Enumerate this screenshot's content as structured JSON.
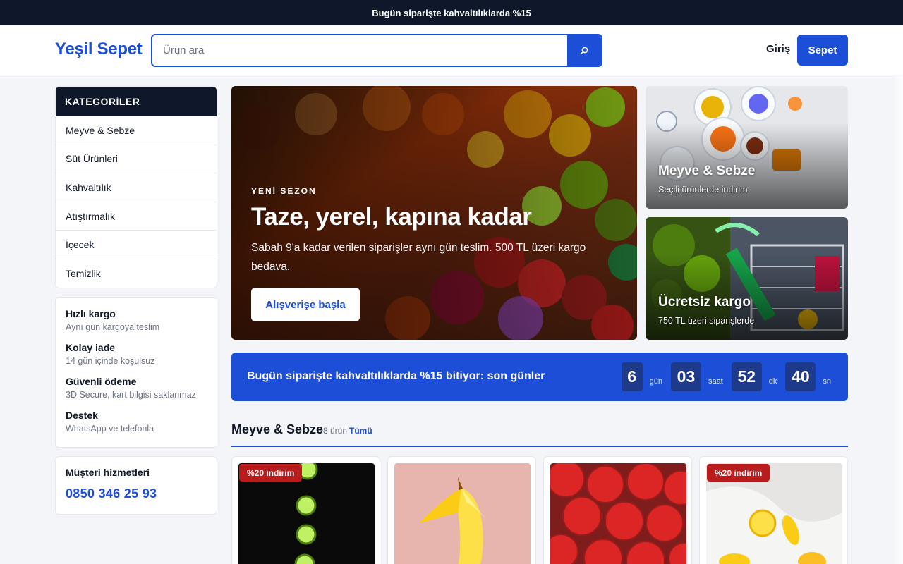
{
  "announcement": "Bugün siparişte kahvaltılıklarda %15",
  "header": {
    "logo": "Yeşil Sepet",
    "search_placeholder": "Ürün ara",
    "search_icon": "search-icon",
    "login_label": "Giriş",
    "cart_label": "Sepet"
  },
  "sidebar": {
    "categories_title": "KATEGORİLER",
    "categories": [
      {
        "label": "Meyve & Sebze"
      },
      {
        "label": "Süt Ürünleri"
      },
      {
        "label": "Kahvaltılık"
      },
      {
        "label": "Atıştırmalık"
      },
      {
        "label": "İçecek"
      },
      {
        "label": "Temizlik"
      }
    ],
    "features": [
      {
        "title": "Hızlı kargo",
        "desc": "Aynı gün kargoya teslim"
      },
      {
        "title": "Kolay iade",
        "desc": "14 gün içinde koşulsuz"
      },
      {
        "title": "Güvenli ödeme",
        "desc": "3D Secure, kart bilgisi saklanmaz"
      },
      {
        "title": "Destek",
        "desc": "WhatsApp ve telefonla"
      }
    ],
    "support": {
      "label": "Müşteri hizmetleri",
      "phone": "0850 346 25 93"
    }
  },
  "hero": {
    "kicker": "YENİ SEZON",
    "title": "Taze, yerel, kapına kadar",
    "subtitle": "Sabah 9'a kadar verilen siparişler aynı gün teslim. 500 TL üzeri kargo bedava.",
    "cta": "Alışverişe başla"
  },
  "promos": [
    {
      "title": "Meyve & Sebze",
      "subtitle": "Seçili ürünlerde indirim"
    },
    {
      "title": "Ücretsiz kargo",
      "subtitle": "750 TL üzeri siparişlerde"
    }
  ],
  "countdown": {
    "text": "Bugün siparişte kahvaltılıklarda %15 bitiyor: son günler",
    "days": "6",
    "days_label": "gün",
    "hours": "03",
    "hours_label": "saat",
    "minutes": "52",
    "minutes_label": "dk",
    "seconds": "40",
    "seconds_label": "sn"
  },
  "section": {
    "title": "Meyve & Sebze",
    "count": "8 ürün",
    "all_label": "Tümü"
  },
  "products": [
    {
      "badge": "%20 indirim"
    },
    {
      "badge": ""
    },
    {
      "badge": ""
    },
    {
      "badge": "%20 indirim"
    }
  ],
  "colors": {
    "brand": "#1d4ed8",
    "dark": "#0f172a",
    "discount": "#b91c1c"
  }
}
